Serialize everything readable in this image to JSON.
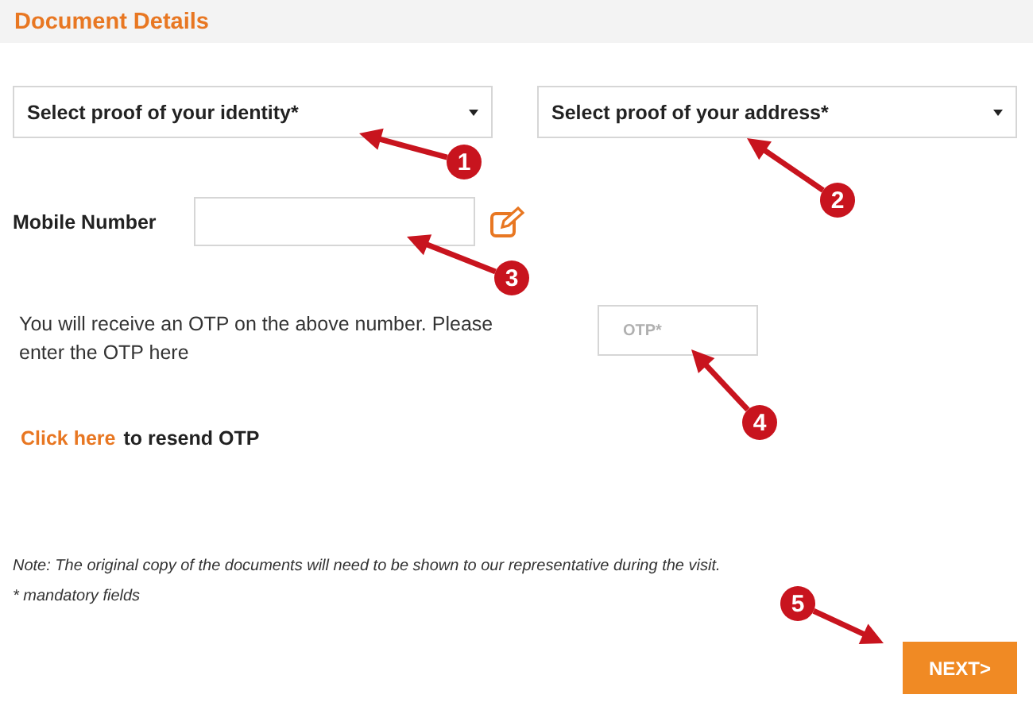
{
  "header": {
    "title": "Document Details"
  },
  "selects": [
    {
      "placeholder": "Select proof of your identity*"
    },
    {
      "placeholder": "Select proof of your address*"
    }
  ],
  "mobile": {
    "label": "Mobile Number"
  },
  "otp": {
    "instruction": "You will receive an OTP on the above number. Please enter the OTP here",
    "placeholder": "OTP*"
  },
  "resend": {
    "link": "Click here",
    "text": "to resend OTP"
  },
  "note": "Note: The original copy of the documents will need to be shown to our representative during the visit.",
  "mandatory": "* mandatory fields",
  "next_button": "NEXT>",
  "callouts": [
    {
      "label": "1"
    },
    {
      "label": "2"
    },
    {
      "label": "3"
    },
    {
      "label": "4"
    },
    {
      "label": "5"
    }
  ]
}
